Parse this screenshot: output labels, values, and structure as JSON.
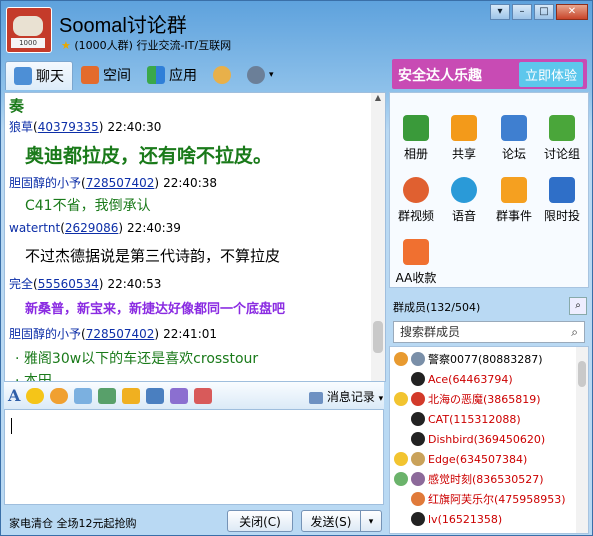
{
  "window": {
    "title": "Soomal讨论群",
    "subtitle": "(1000人群) 行业交流-IT/互联网",
    "avatar_text": "1000"
  },
  "tabs": [
    {
      "label": "聊天",
      "icon": "chat-icon"
    },
    {
      "label": "空间",
      "icon": "home-icon"
    },
    {
      "label": "应用",
      "icon": "apps-icon"
    }
  ],
  "promo": {
    "text": "安全达人乐趣",
    "button": "立即体验"
  },
  "messages": [
    {
      "body": "奏",
      "color": "#1a7a1a"
    },
    {
      "name": "狼草",
      "qq": "40379335",
      "time": "22:40:30",
      "body": "奥迪都拉皮，还有啥不拉皮。",
      "color": "#1a7a1a"
    },
    {
      "name": "胆固醇的小予",
      "qq": "728507402",
      "time": "22:40:38",
      "body": "C41不省，我倒承认",
      "color": "#1a7a1a"
    },
    {
      "name": "watertnt",
      "qq": "2629086",
      "time": "22:40:39",
      "body": "不过杰德据说是第三代诗韵，不算拉皮",
      "color": "#000000"
    },
    {
      "name": "完全",
      "qq": "55560534",
      "time": "22:40:53",
      "body": "新桑普，新宝来，新捷达好像都同一个底盘吧",
      "color": "#8a2be2"
    },
    {
      "name": "胆固醇的小予",
      "qq": "728507402",
      "time": "22:41:01",
      "body": "雅阁30w以下的车还是喜欢crosstour",
      "body2": "本田",
      "color": "#1a7a1a"
    }
  ],
  "input_toolbar": {
    "history": "消息记录"
  },
  "footer": {
    "ad": "家电清仓 全场12元起抢购",
    "close": "关闭(C)",
    "send": "发送(S)"
  },
  "apps": [
    {
      "label": "相册",
      "color": "#3a9a3a"
    },
    {
      "label": "共享",
      "color": "#f39a1a"
    },
    {
      "label": "论坛",
      "color": "#3f7fd0"
    },
    {
      "label": "讨论组",
      "color": "#4aa63a"
    },
    {
      "label": "群视频",
      "color": "#e06030"
    },
    {
      "label": "语音",
      "color": "#2a9ad8"
    },
    {
      "label": "群事件",
      "color": "#f5a020"
    },
    {
      "label": "限时投",
      "color": "#2f6fc8"
    },
    {
      "label": "AA收款",
      "color": "#f07030"
    }
  ],
  "members": {
    "header": "群成员(132/504)",
    "search_placeholder": "搜索群成员",
    "list": [
      {
        "name": "警察0077(80883287)",
        "color": "#000000"
      },
      {
        "name": "Ace(64463794)",
        "color": "#cc0000"
      },
      {
        "name": "北海の恶魔(3865819)",
        "color": "#cc0000"
      },
      {
        "name": "CAT(115312088)",
        "color": "#cc0000"
      },
      {
        "name": "Dishbird(369450620)",
        "color": "#cc0000"
      },
      {
        "name": "Edge(634507384)",
        "color": "#cc0000"
      },
      {
        "name": "感觉时刻(836530527)",
        "color": "#cc0000"
      },
      {
        "name": "红旗阿芙乐尔(475958953)",
        "color": "#cc0000"
      },
      {
        "name": "lv(16521358)",
        "color": "#cc0000"
      }
    ]
  }
}
